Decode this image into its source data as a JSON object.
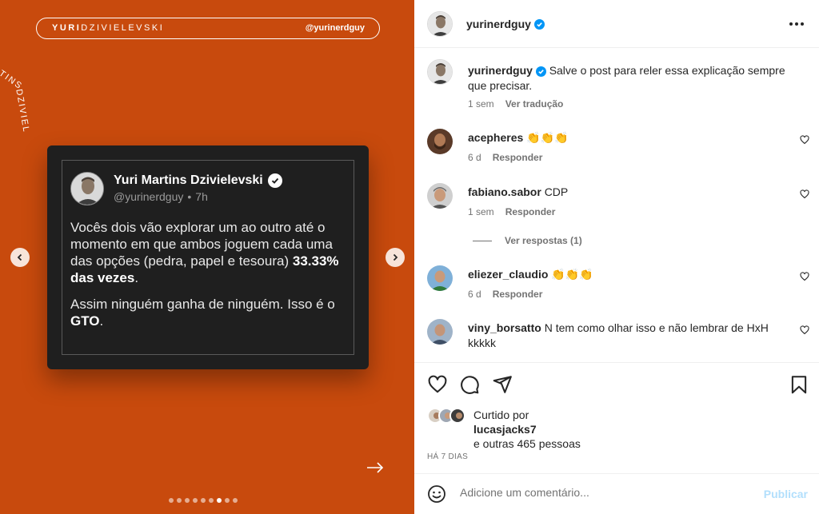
{
  "media": {
    "banner_name_bold": "YURI",
    "banner_name_thin": "DZIVIELEVSKI",
    "banner_handle": "@yurinerdguy",
    "curved_text_1": "TINS",
    "curved_text_2": "DZIVIEL",
    "tweet": {
      "name": "Yuri Martins Dzivielevski",
      "handle": "@yurinerdguy",
      "separator": "•",
      "time": "7h",
      "p1_start": "Vocês dois vão explorar um ao outro até o momento em que ambos joguem cada uma das opções (pedra, papel e tesoura)",
      "p1_bold": "33.33% das vezes",
      "p1_end": ".",
      "p2_start": "Assim ninguém ganha de ninguém. Isso é o",
      "p2_bold": "GTO",
      "p2_end": "."
    },
    "carousel": {
      "total": 9,
      "active_index": 6
    }
  },
  "post": {
    "username": "yurinerdguy",
    "caption": "Salve o post para reler essa explicação sempre que precisar.",
    "caption_time": "1 sem",
    "translate_label": "Ver tradução"
  },
  "comments": [
    {
      "user": "acepheres",
      "text": "",
      "emoji": "👏👏👏",
      "time": "6 d",
      "reply_label": "Responder"
    },
    {
      "user": "fabiano.sabor",
      "text": "CDP",
      "emoji": "",
      "time": "1 sem",
      "reply_label": "Responder"
    },
    {
      "user": "eliezer_claudio",
      "text": "",
      "emoji": "👏👏👏",
      "time": "6 d",
      "reply_label": "Responder"
    },
    {
      "user": "viny_borsatto",
      "text": "N tem como olhar isso e não lembrar de HxH kkkkk",
      "emoji": ""
    }
  ],
  "view_replies_label": "Ver respostas (1)",
  "likes": {
    "prefix": "Curtido por",
    "user": "lucasjacks7",
    "others": "e outras 465 pessoas"
  },
  "date_label": "HÁ 7 DIAS",
  "comment_box": {
    "placeholder": "Adicione um comentário...",
    "publish_label": "Publicar"
  },
  "colors": {
    "media_bg": "#c84a0d",
    "verified": "#0095f6",
    "publish_disabled": "#b2dffc"
  },
  "icons": [
    "more-icon",
    "heart-icon",
    "comment-icon",
    "share-icon",
    "bookmark-icon",
    "emoji-icon",
    "chevron-left-icon",
    "chevron-right-icon",
    "arrow-right-icon",
    "verified-icon"
  ]
}
